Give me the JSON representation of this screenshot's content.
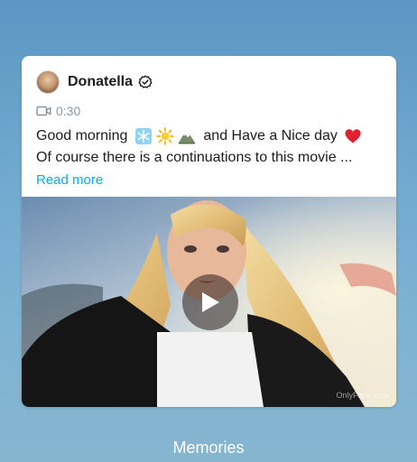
{
  "post": {
    "author": "Donatella",
    "duration": "0:30",
    "text_line1_start": "Good morning",
    "text_line1_end": "and Have a Nice day",
    "text_line2": "Of course there is a continuations to this movie ...",
    "read_more": "Read more",
    "watermark": "OnlyFans.com/",
    "emoji_icons": [
      "snowflake-icon",
      "sun-icon",
      "mountain-icon",
      "red-heart-icon"
    ]
  },
  "footer": {
    "label": "Memories"
  },
  "colors": {
    "accent": "#00aff0",
    "muted": "#8a96a3",
    "heart": "#e02230"
  }
}
